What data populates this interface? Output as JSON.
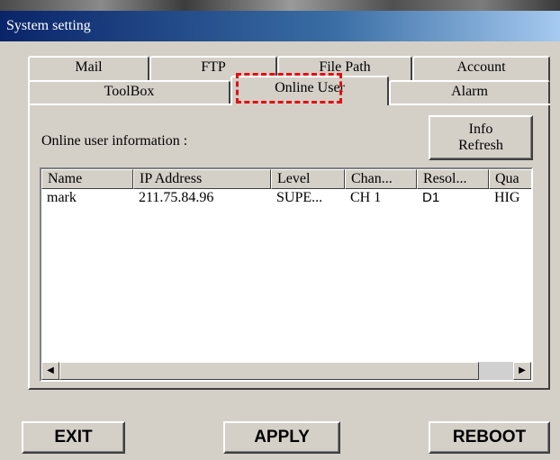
{
  "window": {
    "title": "System setting"
  },
  "tabs": {
    "row1": [
      "Mail",
      "FTP",
      "File Path",
      "Account"
    ],
    "row2": [
      "ToolBox",
      "Online User",
      "Alarm"
    ],
    "selected": "Online User"
  },
  "online_user": {
    "info_label": "Online user information :",
    "refresh_line1": "Info",
    "refresh_line2": "Refresh",
    "columns": [
      "Name",
      "IP Address",
      "Level",
      "Chan...",
      "Resol...",
      "Qua"
    ],
    "rows": [
      [
        "mark",
        "211.75.84.96",
        "SUPE...",
        "CH 1",
        "D1",
        "HIG"
      ]
    ]
  },
  "scrollbar": {
    "left_icon": "scroll-left-arrow",
    "right_icon": "scroll-right-arrow"
  },
  "buttons": {
    "exit": "EXIT",
    "apply": "APPLY",
    "reboot": "REBOOT"
  },
  "colors": {
    "face": "#d4d0c8",
    "titlebar": "#0a246a",
    "highlight": "#e01010"
  }
}
